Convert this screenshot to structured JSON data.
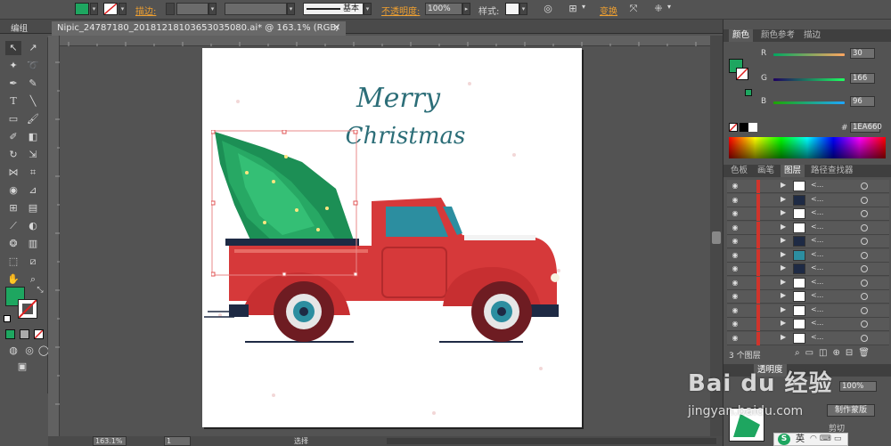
{
  "control_bar": {
    "stroke_label": "描边:",
    "stroke_style_label": "基本",
    "opacity_label": "不透明度:",
    "opacity_value": "100%",
    "style_label": "样式:",
    "transform_label": "变换"
  },
  "menu": {
    "group_label": "编组"
  },
  "document": {
    "tab_title": "Nipic_24787180_20181218103653035080.ai* @ 163.1% (RGB/预览)",
    "zoom_value": "163.1%",
    "page_value": "1",
    "status_text": "选择"
  },
  "artwork": {
    "line1": "Merry",
    "line2": "Christmas"
  },
  "color_panel": {
    "tabs": [
      "颜色",
      "颜色参考",
      "描边"
    ],
    "channels": [
      {
        "name": "R",
        "value": "30"
      },
      {
        "name": "G",
        "value": "166"
      },
      {
        "name": "B",
        "value": "96"
      }
    ],
    "hex_label": "#",
    "hex_value": "1EA660",
    "fill_color": "#1EA660"
  },
  "layers_panel": {
    "tabs": [
      "色板",
      "画笔",
      "图层",
      "路径查找器"
    ],
    "row_label": "<...",
    "row_count": 12,
    "count_text": "3 个图层"
  },
  "lower_panel": {
    "tab_label": "透明度",
    "opacity_value": "100%",
    "mask_button": "制作蒙版",
    "clip_label": "剪切"
  },
  "watermark": {
    "brand": "Bai du 经验",
    "url": "jingyan.baidu.com"
  },
  "ime": {
    "lang": "英"
  }
}
